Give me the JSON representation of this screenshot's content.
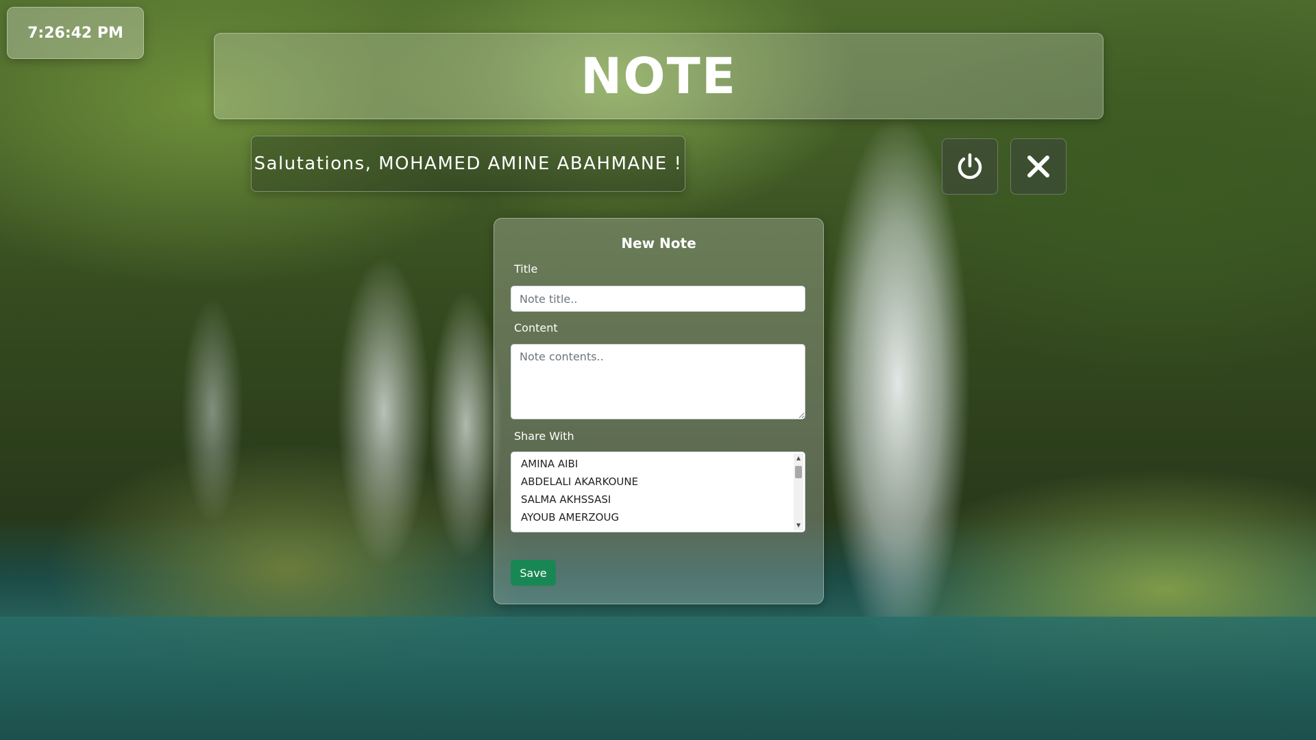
{
  "clock": {
    "time": "7:26:42 PM"
  },
  "header": {
    "title": "NOTE"
  },
  "greeting": {
    "text": "Salutations, MOHAMED AMINE ABAHMANE !"
  },
  "toolbar": {
    "power_icon": "power-icon",
    "close_icon": "close-icon"
  },
  "form": {
    "heading": "New Note",
    "title_label": "Title",
    "title_placeholder": "Note title..",
    "title_value": "",
    "content_label": "Content",
    "content_placeholder": "Note contents..",
    "content_value": "",
    "share_label": "Share With",
    "share_options": [
      "AMINA AIBI",
      "ABDELALI AKARKOUNE",
      "SALMA AKHSSASI",
      "AYOUB AMERZOUG"
    ],
    "save_label": "Save"
  },
  "colors": {
    "save_button": "#198754",
    "text_on_glass": "#ffffff"
  }
}
